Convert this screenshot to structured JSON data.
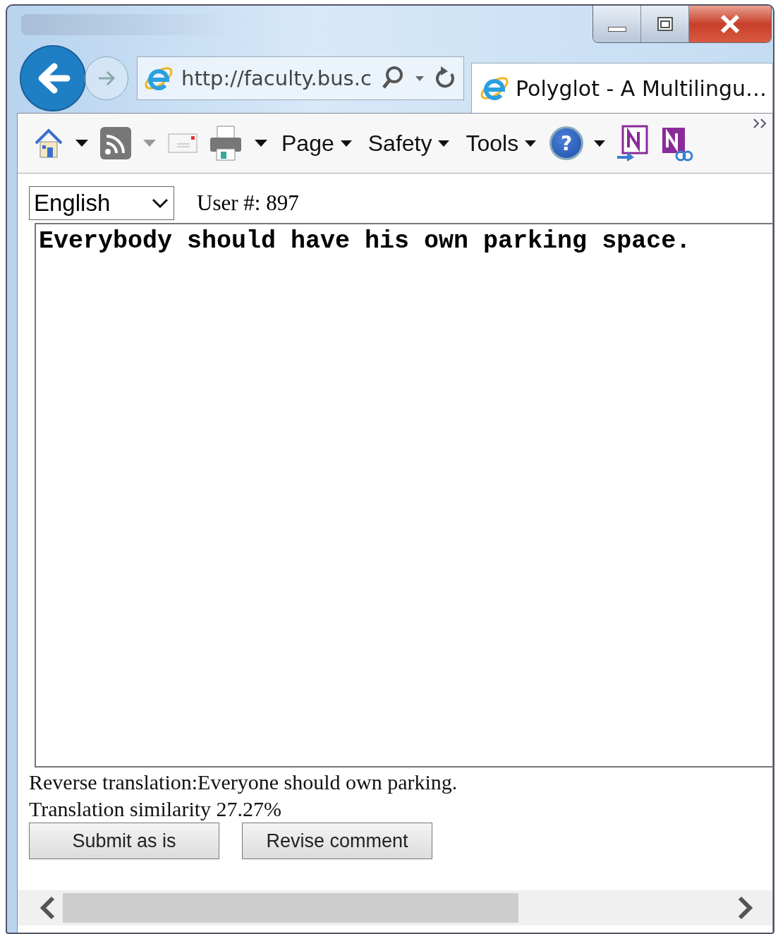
{
  "browser": {
    "address": "http://faculty.bus.c",
    "tab_title": "Polyglot - A Multilingu…"
  },
  "command_bar": {
    "menus": [
      "Page",
      "Safety",
      "Tools"
    ],
    "help": "?"
  },
  "page": {
    "language": "English",
    "user": "User #: 897",
    "comment": "Everybody should have his own parking space.",
    "reverse_translation": "Reverse translation:Everyone should own parking.",
    "similarity": "Translation similarity 27.27%",
    "buttons": [
      "Submit as is",
      "Revise comment"
    ]
  }
}
